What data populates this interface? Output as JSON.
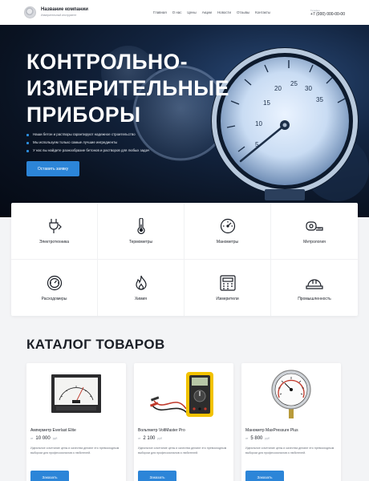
{
  "company": {
    "name": "Название компании",
    "subtitle": "Измерительный инструмент"
  },
  "nav": [
    "Главная",
    "О нас",
    "Цены",
    "Акции",
    "Новости",
    "Отзывы",
    "Контакты"
  ],
  "phone": {
    "hint": "Телефон",
    "number": "+7 (000) 000-00-00"
  },
  "hero": {
    "title": "КОНТРОЛЬНО-ИЗМЕРИТЕЛЬНЫЕ ПРИБОРЫ",
    "bullets": [
      "Наши бетон и растворы гарантируют надежное строительство",
      "Мы используем только самые лучшие ингредиенты",
      "У нас вы найдете разнообразие бетонов и растворов для любых задач"
    ],
    "cta": "Оставить заявку"
  },
  "categories": [
    {
      "label": "Электротехника",
      "icon": "plug-icon"
    },
    {
      "label": "Термометры",
      "icon": "thermometer-icon"
    },
    {
      "label": "Манометры",
      "icon": "gauge-icon"
    },
    {
      "label": "Метрология",
      "icon": "tape-measure-icon"
    },
    {
      "label": "Расходомеры",
      "icon": "flowmeter-icon"
    },
    {
      "label": "Химия",
      "icon": "flame-icon"
    },
    {
      "label": "Измерители",
      "icon": "calculator-icon"
    },
    {
      "label": "Промышленность",
      "icon": "hardhat-icon"
    }
  ],
  "catalog": {
    "title": "КАТАЛОГ ТОВАРОВ",
    "products": [
      {
        "name": "Амперметр Everlast Elite",
        "price_from": "от",
        "price": "10 000",
        "currency": "руб",
        "description": "Идеальное сочетание цены и качества делают это превосходным выбором для профессионалов и любителей.",
        "button": "Заказать"
      },
      {
        "name": "Вольтметр VoltMaster Pro",
        "price_from": "от",
        "price": "2 100",
        "currency": "руб",
        "description": "Идеальное сочетание цены и качества делают это превосходным выбором для профессионалов и любителей.",
        "button": "Заказать"
      },
      {
        "name": "Манометр MaxPressure Plus",
        "price_from": "от",
        "price": "5 800",
        "currency": "руб",
        "description": "Идеальное сочетание цены и качества делают это превосходным выбором для профессионалов и любителей.",
        "button": "Заказать"
      }
    ]
  },
  "colors": {
    "accent": "#2c85d8",
    "hero_dark": "#0a1322",
    "text": "#1b1f27"
  }
}
